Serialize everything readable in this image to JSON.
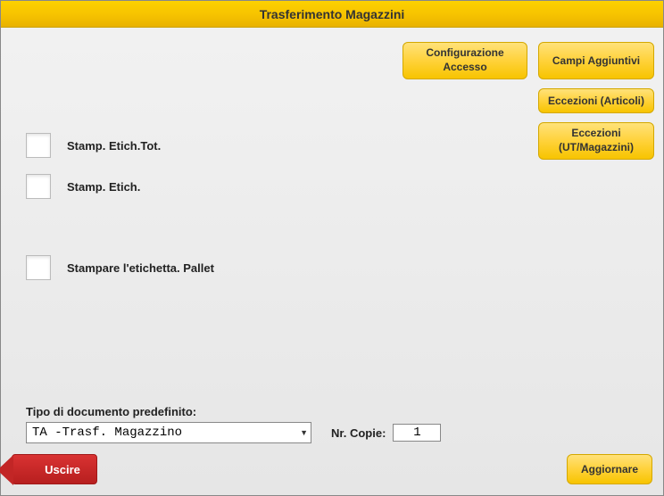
{
  "header": {
    "title": "Trasferimento Magazzini"
  },
  "topButtons": {
    "config": "Configurazione Accesso",
    "campi": "Campi Aggiuntivi",
    "eccezioniArticoli": "Eccezioni (Articoli)",
    "eccezioniUT": "Eccezioni (UT/Magazzini)"
  },
  "checkboxes": {
    "stampEtichTot": "Stamp. Etich.Tot.",
    "stampEtich": "Stamp. Etich.",
    "stamparePallet": "Stampare l'etichetta. Pallet"
  },
  "docType": {
    "label": "Tipo di documento predefinito:",
    "selected": "TA -Trasf. Magazzino",
    "copieLabel": "Nr. Copie:",
    "copieValue": "1"
  },
  "footer": {
    "exit": "Uscire",
    "update": "Aggiornare"
  }
}
